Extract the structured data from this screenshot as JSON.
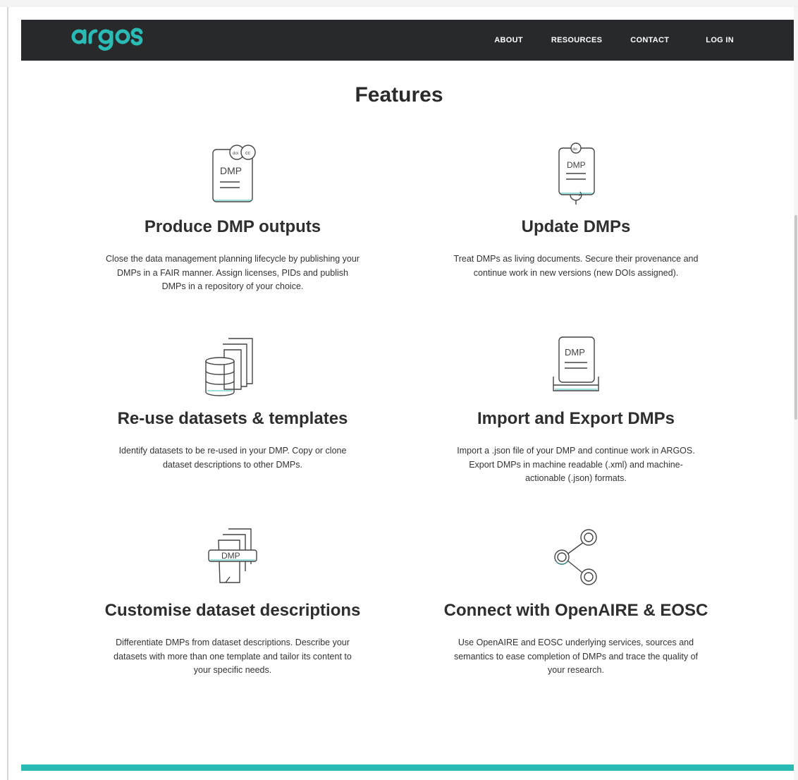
{
  "nav": {
    "brand": "argos",
    "links": [
      {
        "label": "ABOUT"
      },
      {
        "label": "RESOURCES"
      },
      {
        "label": "CONTACT"
      },
      {
        "label": "LOG IN"
      }
    ]
  },
  "page_title": "Features",
  "features": [
    {
      "title": "Produce DMP outputs",
      "description": "Close the data management planning lifecycle by publishing your DMPs in a FAIR manner. Assign licenses, PIDs and publish DMPs in a repository of your choice.",
      "icon": "dmp-license-icon",
      "icon_text": "DMP"
    },
    {
      "title": "Update DMPs",
      "description": "Treat DMPs as living documents. Secure their provenance and continue work in new versions (new DOIs assigned).",
      "icon": "dmp-version-icon",
      "icon_text": "DMP"
    },
    {
      "title": "Re-use datasets & templates",
      "description": "Identify datasets to be re-used in your DMP. Copy or clone dataset descriptions to other DMPs.",
      "icon": "database-documents-icon"
    },
    {
      "title": "Import and Export DMPs",
      "description": "Import a .json file of your DMP and continue work in ARGOS. Export DMPs in machine readable (.xml) and machine-actionable (.json) formats.",
      "icon": "dmp-import-export-icon",
      "icon_text": "DMP"
    },
    {
      "title": "Customise dataset descriptions",
      "description": "Differentiate DMPs from dataset descriptions. Describe your datasets with more than one template and tailor its content to your specific needs.",
      "icon": "dmp-templates-icon",
      "icon_text": "DMP"
    },
    {
      "title": "Connect with OpenAIRE & EOSC",
      "description": "Use OpenAIRE and EOSC underlying services, sources and semantics to ease completion of DMPs and trace the quality of your research.",
      "icon": "share-network-icon"
    }
  ],
  "colors": {
    "navbar": "#27292b",
    "accent": "#2bbbb5",
    "text": "#2e2e2e"
  }
}
